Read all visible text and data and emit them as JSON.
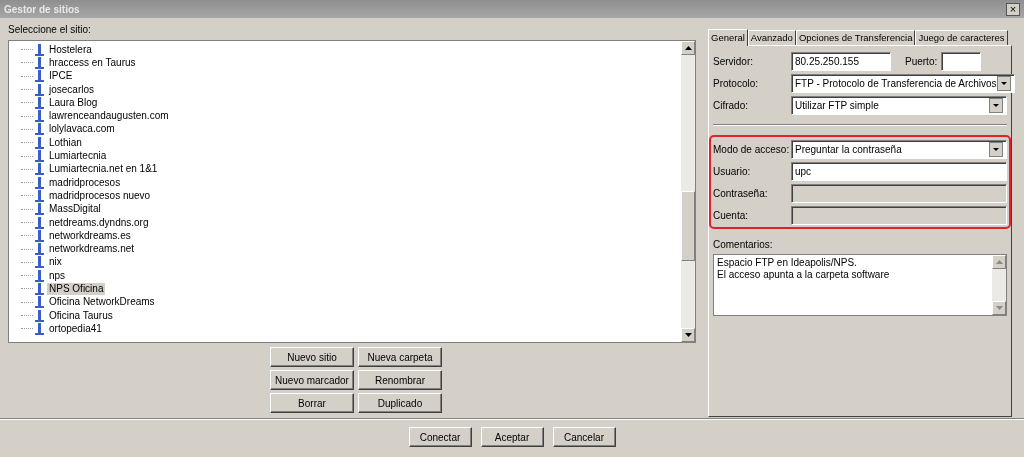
{
  "window": {
    "title": "Gestor de sitios",
    "close": "×"
  },
  "tree": {
    "label": "Seleccione el sitio:",
    "items": [
      {
        "label": "Hostelera",
        "selected": false
      },
      {
        "label": "hraccess en Taurus",
        "selected": false
      },
      {
        "label": "IPCE",
        "selected": false
      },
      {
        "label": "josecarlos",
        "selected": false
      },
      {
        "label": "Laura Blog",
        "selected": false
      },
      {
        "label": "lawrenceandaugusten.com",
        "selected": false
      },
      {
        "label": "lolylavaca.com",
        "selected": false
      },
      {
        "label": "Lothian",
        "selected": false
      },
      {
        "label": "Lumiartecnia",
        "selected": false
      },
      {
        "label": "Lumiartecnia.net en 1&1",
        "selected": false
      },
      {
        "label": "madridprocesos",
        "selected": false
      },
      {
        "label": "madridprocesos nuevo",
        "selected": false
      },
      {
        "label": "MassDigital",
        "selected": false
      },
      {
        "label": "netdreams.dyndns.org",
        "selected": false
      },
      {
        "label": "networkdreams.es",
        "selected": false
      },
      {
        "label": "networkdreams.net",
        "selected": false
      },
      {
        "label": "nix",
        "selected": false
      },
      {
        "label": "nps",
        "selected": false
      },
      {
        "label": "NPS Oficina",
        "selected": true
      },
      {
        "label": "Oficina NetworkDreams",
        "selected": false
      },
      {
        "label": "Oficina Taurus",
        "selected": false
      },
      {
        "label": "ortopedia41",
        "selected": false
      }
    ]
  },
  "site_buttons": [
    [
      "Nuevo sitio",
      "Nueva carpeta"
    ],
    [
      "Nuevo marcador",
      "Renombrar"
    ],
    [
      "Borrar",
      "Duplicado"
    ]
  ],
  "tabs": [
    {
      "label": "General",
      "selected": true
    },
    {
      "label": "Avanzado",
      "selected": false
    },
    {
      "label": "Opciones de Transferencia",
      "selected": false
    },
    {
      "label": "Juego de caracteres",
      "selected": false
    }
  ],
  "server": {
    "label": "Servidor:",
    "value": "80.25.250.155",
    "port_label": "Puerto:"
  },
  "fields": [
    {
      "kind": "select",
      "label": "Protocolo:",
      "value": "FTP - Protocolo de Transferencia de Archivos",
      "disabled": false
    },
    {
      "kind": "select",
      "label": "Cifrado:",
      "value": "Utilizar FTP simple",
      "disabled": false
    }
  ],
  "access": {
    "highlighted": true,
    "fields": [
      {
        "kind": "select",
        "label": "Modo de acceso:",
        "value": "Preguntar la contraseña",
        "disabled": false
      },
      {
        "kind": "text",
        "label": "Usuario:",
        "value": "upc",
        "disabled": false
      },
      {
        "kind": "text",
        "label": "Contraseña:",
        "disabled": true
      },
      {
        "kind": "text",
        "label": "Cuenta:",
        "disabled": true
      }
    ]
  },
  "comments": {
    "label": "Comentarios:",
    "lines": [
      "Espacio FTP en Ideapolis/NPS.",
      "El acceso apunta a la carpeta software"
    ]
  },
  "dialog_buttons": [
    "Conectar",
    "Aceptar",
    "Cancelar"
  ]
}
